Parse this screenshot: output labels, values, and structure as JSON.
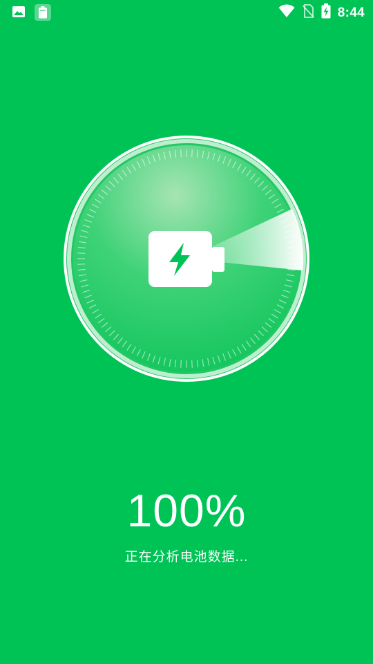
{
  "status_bar": {
    "time": "8:44",
    "left_icons": [
      "image-icon",
      "battery-saver-app-icon"
    ],
    "right_icons": [
      "wifi-icon",
      "no-sim-icon",
      "battery-charging-icon"
    ]
  },
  "gauge": {
    "icon": "battery-charging-icon",
    "progress_percent": 100
  },
  "analysis": {
    "percent": "100%",
    "status": "正在分析电池数据..."
  },
  "colors": {
    "background": "#00C356",
    "ring": "#FFFFFF"
  }
}
